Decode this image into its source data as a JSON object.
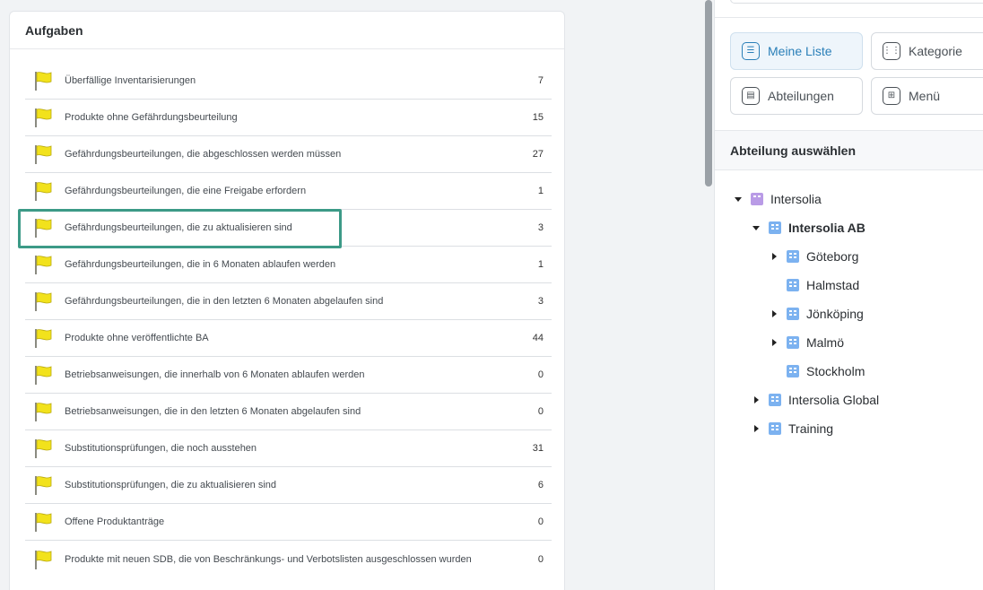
{
  "tasks": {
    "title": "Aufgaben",
    "items": [
      {
        "label": "Überfällige Inventarisierungen",
        "count": "7"
      },
      {
        "label": "Produkte ohne Gefährdungsbeurteilung",
        "count": "15"
      },
      {
        "label": "Gefährdungsbeurteilungen, die abgeschlossen werden müssen",
        "count": "27"
      },
      {
        "label": "Gefährdungsbeurteilungen, die eine Freigabe erfordern",
        "count": "1"
      },
      {
        "label": "Gefährdungsbeurteilungen, die zu aktualisieren sind",
        "count": "3"
      },
      {
        "label": "Gefährdungsbeurteilungen, die in 6 Monaten ablaufen werden",
        "count": "1"
      },
      {
        "label": "Gefährdungsbeurteilungen, die in den letzten 6 Monaten abgelaufen sind",
        "count": "3"
      },
      {
        "label": "Produkte ohne veröffentlichte BA",
        "count": "44"
      },
      {
        "label": "Betriebsanweisungen, die innerhalb von 6 Monaten ablaufen werden",
        "count": "0"
      },
      {
        "label": "Betriebsanweisungen, die in den letzten 6 Monaten abgelaufen sind",
        "count": "0"
      },
      {
        "label": "Substitutionsprüfungen, die noch ausstehen",
        "count": "31"
      },
      {
        "label": "Substitutionsprüfungen, die zu aktualisieren sind",
        "count": "6"
      },
      {
        "label": "Offene Produktanträge",
        "count": "0"
      },
      {
        "label": "Produkte mit neuen SDB, die von Beschränkungs- und Verbotslisten ausgeschlossen wurden",
        "count": "0"
      }
    ]
  },
  "nav": {
    "buttons": [
      {
        "label": "Meine Liste",
        "icon": "list-icon",
        "active": true
      },
      {
        "label": "Kategorie",
        "icon": "category-icon",
        "active": false
      },
      {
        "label": "Abteilungen",
        "icon": "departments-icon",
        "active": false
      },
      {
        "label": "Menü",
        "icon": "menu-grid-icon",
        "active": false
      }
    ]
  },
  "departments": {
    "title": "Abteilung auswählen",
    "tree": [
      {
        "label": "Intersolia",
        "caret": "expanded",
        "icon": "org-icon"
      },
      {
        "label": "Intersolia AB",
        "caret": "expanded",
        "icon": "building-icon",
        "bold": true
      },
      {
        "label": "Göteborg",
        "caret": "collapsed",
        "icon": "building-icon"
      },
      {
        "label": "Halmstad",
        "caret": "none",
        "icon": "building-icon"
      },
      {
        "label": "Jönköping",
        "caret": "collapsed",
        "icon": "building-icon"
      },
      {
        "label": "Malmö",
        "caret": "collapsed",
        "icon": "building-icon"
      },
      {
        "label": "Stockholm",
        "caret": "none",
        "icon": "building-icon"
      },
      {
        "label": "Intersolia Global",
        "caret": "collapsed",
        "icon": "building-icon"
      },
      {
        "label": "Training",
        "caret": "collapsed",
        "icon": "building-icon"
      }
    ]
  },
  "colors": {
    "accent": "#3c9a87",
    "flag": "#f2e21c",
    "active_button": "#2a7fb8",
    "building_icon": "#7cb2f0",
    "org_icon": "#b99be6"
  }
}
